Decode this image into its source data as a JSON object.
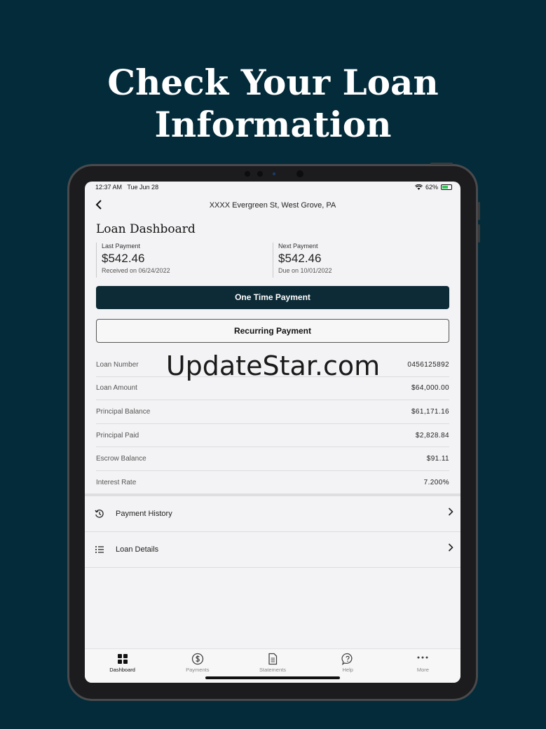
{
  "headline": {
    "line1": "Check Your Loan",
    "line2": "Information"
  },
  "status_bar": {
    "time": "12:37 AM",
    "date": "Tue Jun 28",
    "battery": "62%"
  },
  "nav": {
    "back_icon": "chevron-left-icon",
    "address": "XXXX Evergreen St, West Grove, PA"
  },
  "dashboard": {
    "title": "Loan Dashboard"
  },
  "last_payment": {
    "label": "Last Payment",
    "amount": "$542.46",
    "sub": "Received on 06/24/2022"
  },
  "next_payment": {
    "label": "Next Payment",
    "amount": "$542.46",
    "sub": "Due on 10/01/2022"
  },
  "buttons": {
    "one_time": "One Time Payment",
    "recurring": "Recurring Payment"
  },
  "loan_info": [
    {
      "label": "Loan Number",
      "value": "0456125892"
    },
    {
      "label": "Loan Amount",
      "value": "$64,000.00"
    },
    {
      "label": "Principal Balance",
      "value": "$61,171.16"
    },
    {
      "label": "Principal Paid",
      "value": "$2,828.84"
    },
    {
      "label": "Escrow Balance",
      "value": "$91.11"
    },
    {
      "label": "Interest Rate",
      "value": "7.200%"
    }
  ],
  "links": [
    {
      "label": "Payment History",
      "icon": "history-icon"
    },
    {
      "label": "Loan Details",
      "icon": "list-icon"
    }
  ],
  "watermark": "UpdateStar.com",
  "tabs": [
    {
      "label": "Dashboard",
      "icon": "dashboard-icon",
      "active": true
    },
    {
      "label": "Payments",
      "icon": "dollar-icon",
      "active": false
    },
    {
      "label": "Statements",
      "icon": "document-icon",
      "active": false
    },
    {
      "label": "Help",
      "icon": "help-icon",
      "active": false
    },
    {
      "label": "More",
      "icon": "more-icon",
      "active": false
    }
  ],
  "colors": {
    "background": "#032b3a",
    "primary_button": "#0d2b36",
    "screen": "#f3f3f5"
  }
}
